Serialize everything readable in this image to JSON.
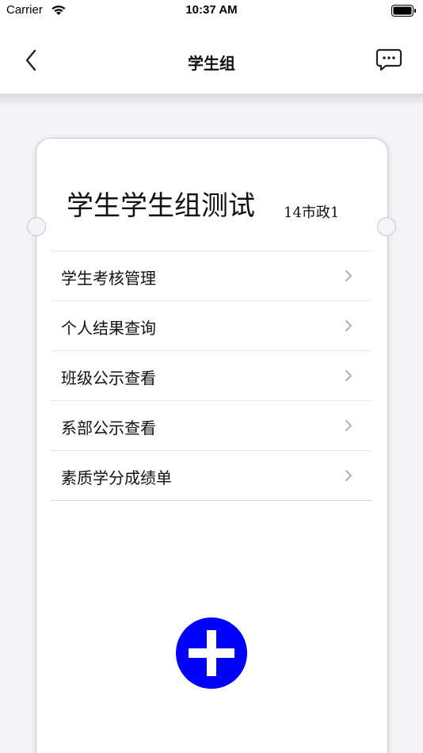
{
  "status_bar": {
    "carrier": "Carrier",
    "time": "10:37 AM",
    "icons": [
      "wifi-icon",
      "battery-icon"
    ]
  },
  "nav": {
    "title": "学生组",
    "back_icon": "chevron-left-icon",
    "message_icon": "message-icon"
  },
  "card": {
    "title": "学生学生组测试",
    "class_name": "14市政1",
    "menu_items": [
      {
        "label": "学生考核管理",
        "icon": "chevron-right-icon"
      },
      {
        "label": "个人结果查询",
        "icon": "chevron-right-icon"
      },
      {
        "label": "班级公示查看",
        "icon": "chevron-right-icon"
      },
      {
        "label": "系部公示查看",
        "icon": "chevron-right-icon"
      },
      {
        "label": "素质学分成绩单",
        "icon": "chevron-right-icon"
      }
    ]
  },
  "fab": {
    "icon": "plus-icon",
    "color": "#0000ff"
  },
  "colors": {
    "background": "#f3f4f8",
    "card": "#ffffff",
    "accent": "#0000ff"
  }
}
